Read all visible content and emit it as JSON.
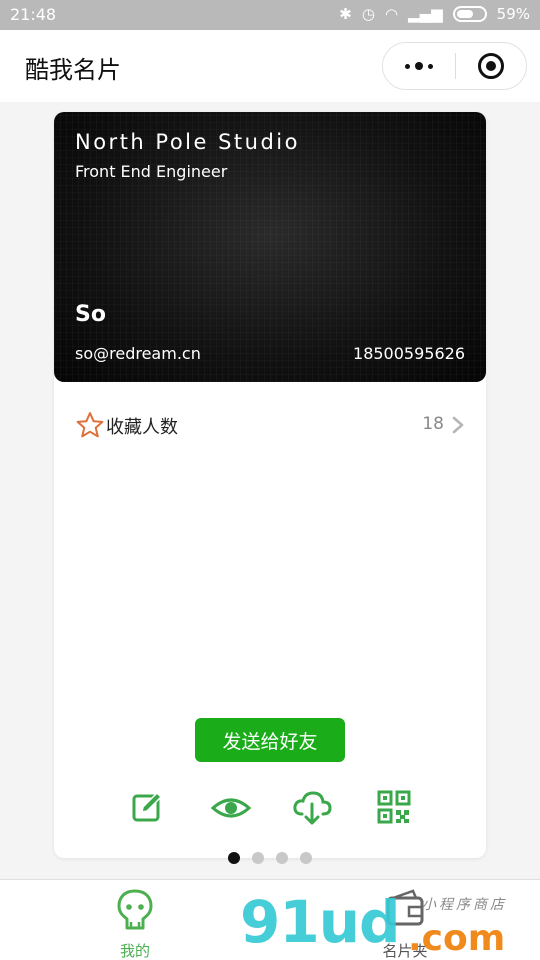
{
  "status_bar": {
    "time": "21:48",
    "battery": "59%"
  },
  "nav": {
    "title": "酷我名片"
  },
  "card": {
    "company": "North Pole Studio",
    "title": "Front End Engineer",
    "name": "So",
    "email": "so@redream.cn",
    "phone": "18500595626"
  },
  "favorites": {
    "label": "收藏人数",
    "count": "18"
  },
  "actions": {
    "send_label": "发送给好友",
    "icons": [
      "edit-icon",
      "eye-icon",
      "cloud-download-icon",
      "qrcode-icon"
    ]
  },
  "pager": {
    "total": 4,
    "active": 0
  },
  "tabs": [
    {
      "label": "我的",
      "icon": "face-icon",
      "active": true,
      "color": "#4caf50"
    },
    {
      "label": "名片夹",
      "icon": "cardholder-icon",
      "active": false,
      "color": "#555555"
    }
  ],
  "watermark": {
    "main": "91ud",
    "sub": "小程序商店",
    "suffix": ".com"
  },
  "colors": {
    "accent": "#1aad19",
    "icon_green": "#3aa84a",
    "star": "#e0703a"
  }
}
